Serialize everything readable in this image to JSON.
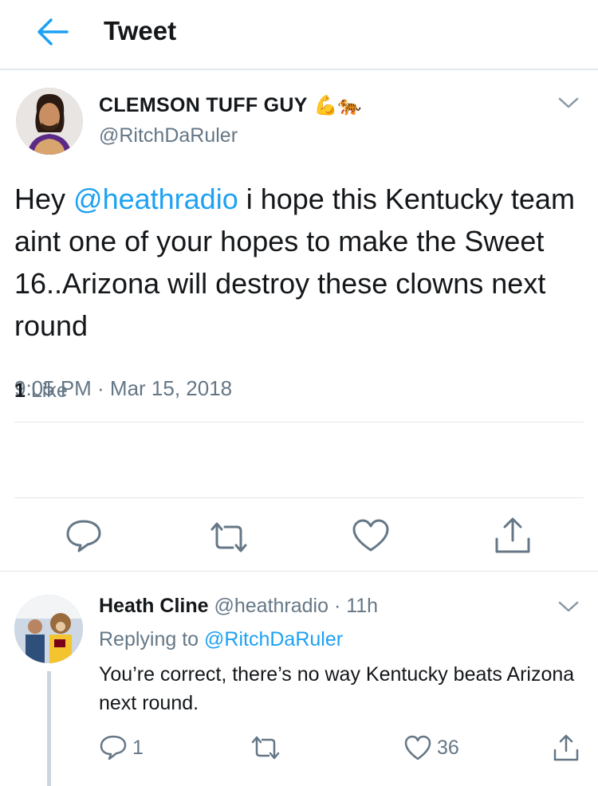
{
  "header": {
    "title": "Tweet",
    "back_icon": "arrow-left-icon"
  },
  "tweet": {
    "display_name": "CLEMSON TUFF GUY",
    "name_emoji": "💪🐅",
    "handle": "@RitchDaRuler",
    "text_before": "Hey ",
    "mention": "@heathradio",
    "text_after": " i hope this Kentucky team aint one of your hopes to make the Sweet 16..Arizona will destroy these clowns next round",
    "timestamp": "9:05 PM · Mar 15, 2018",
    "likes_count": "1",
    "likes_label": "Like",
    "actions": [
      "reply-icon",
      "retweet-icon",
      "like-icon",
      "share-icon"
    ]
  },
  "reply": {
    "display_name": "Heath Cline",
    "meta": "@heathradio · 11h",
    "replying_label": "Replying to",
    "replying_to": "@RitchDaRuler",
    "text": "You’re correct, there’s no way Kentucky beats Arizona next round.",
    "reply_count": "1",
    "like_count": "36"
  },
  "colors": {
    "accent": "#1da1f2",
    "secondary_text": "#657786",
    "divider": "#e1e8ed"
  }
}
